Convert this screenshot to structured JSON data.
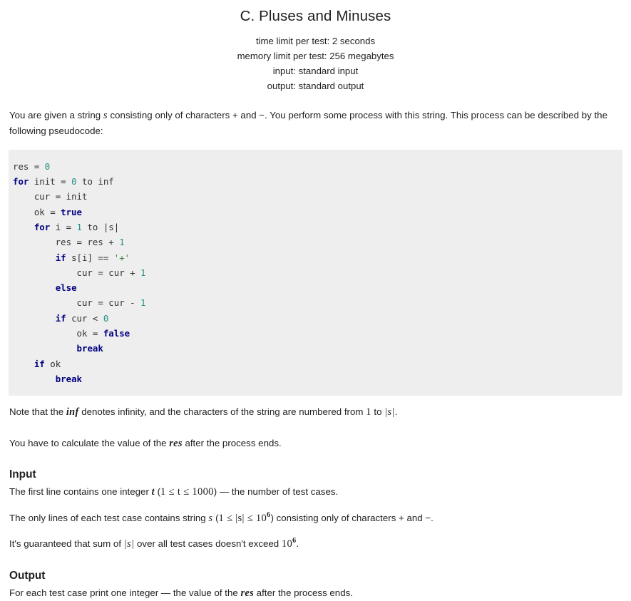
{
  "header": {
    "title": "C. Pluses and Minuses",
    "time_limit": "time limit per test: 2 seconds",
    "memory_limit": "memory limit per test: 256 megabytes",
    "input_spec": "input: standard input",
    "output_spec": "output: standard output"
  },
  "statement": {
    "part1": "You are given a string ",
    "var_s": "s",
    "part2": " consisting only of characters + and −. You perform some process with this string. This process can be described by the following pseudocode:"
  },
  "code": {
    "lines": [
      [
        {
          "t": "res ",
          "c": "id"
        },
        {
          "t": "= ",
          "c": "op"
        },
        {
          "t": "0",
          "c": "num"
        }
      ],
      [
        {
          "t": "for ",
          "c": "kw"
        },
        {
          "t": "init ",
          "c": "id"
        },
        {
          "t": "= ",
          "c": "op"
        },
        {
          "t": "0 ",
          "c": "num"
        },
        {
          "t": "to inf",
          "c": "id"
        }
      ],
      [
        {
          "t": "    cur ",
          "c": "id"
        },
        {
          "t": "= ",
          "c": "op"
        },
        {
          "t": "init",
          "c": "id"
        }
      ],
      [
        {
          "t": "    ok ",
          "c": "id"
        },
        {
          "t": "= ",
          "c": "op"
        },
        {
          "t": "true",
          "c": "kw"
        }
      ],
      [
        {
          "t": "    ",
          "c": "id"
        },
        {
          "t": "for ",
          "c": "kw"
        },
        {
          "t": "i ",
          "c": "id"
        },
        {
          "t": "= ",
          "c": "op"
        },
        {
          "t": "1 ",
          "c": "num"
        },
        {
          "t": "to |s|",
          "c": "id"
        }
      ],
      [
        {
          "t": "        res ",
          "c": "id"
        },
        {
          "t": "= ",
          "c": "op"
        },
        {
          "t": "res + ",
          "c": "id"
        },
        {
          "t": "1",
          "c": "num"
        }
      ],
      [
        {
          "t": "        ",
          "c": "id"
        },
        {
          "t": "if ",
          "c": "kw"
        },
        {
          "t": "s[i] == ",
          "c": "id"
        },
        {
          "t": "'+'",
          "c": "str"
        }
      ],
      [
        {
          "t": "            cur ",
          "c": "id"
        },
        {
          "t": "= ",
          "c": "op"
        },
        {
          "t": "cur + ",
          "c": "id"
        },
        {
          "t": "1",
          "c": "num"
        }
      ],
      [
        {
          "t": "        ",
          "c": "id"
        },
        {
          "t": "else",
          "c": "kw"
        }
      ],
      [
        {
          "t": "            cur ",
          "c": "id"
        },
        {
          "t": "= ",
          "c": "op"
        },
        {
          "t": "cur - ",
          "c": "id"
        },
        {
          "t": "1",
          "c": "num"
        }
      ],
      [
        {
          "t": "        ",
          "c": "id"
        },
        {
          "t": "if ",
          "c": "kw"
        },
        {
          "t": "cur < ",
          "c": "id"
        },
        {
          "t": "0",
          "c": "num"
        }
      ],
      [
        {
          "t": "            ok ",
          "c": "id"
        },
        {
          "t": "= ",
          "c": "op"
        },
        {
          "t": "false",
          "c": "kw"
        }
      ],
      [
        {
          "t": "            ",
          "c": "id"
        },
        {
          "t": "break",
          "c": "kw"
        }
      ],
      [
        {
          "t": "    ",
          "c": "id"
        },
        {
          "t": "if ",
          "c": "kw"
        },
        {
          "t": "ok",
          "c": "id"
        }
      ],
      [
        {
          "t": "        ",
          "c": "id"
        },
        {
          "t": "break",
          "c": "kw"
        }
      ]
    ]
  },
  "notes": {
    "note1_a": "Note that the ",
    "note1_inf": "inf",
    "note1_b": " denotes infinity, and the characters of the string are numbered from ",
    "note1_one": "1",
    "note1_c": " to ",
    "note1_abs_s": "|s|",
    "note1_d": ".",
    "note2_a": "You have to calculate the value of the ",
    "note2_res": "res",
    "note2_b": " after the process ends."
  },
  "input_section": {
    "title": "Input",
    "line1_a": "The first line contains one integer ",
    "line1_t": "t",
    "line1_b": " (",
    "line1_range": "1 ≤ t ≤ 1000",
    "line1_c": ") — the number of test cases.",
    "line2_a": "The only lines of each test case contains string ",
    "line2_s": "s",
    "line2_b": " (",
    "line2_range_lo": "1 ≤ |s| ≤ 10",
    "line2_range_exp": "6",
    "line2_c": ") consisting only of characters + and −.",
    "line3_a": "It's guaranteed that sum of ",
    "line3_abs_s": "|s|",
    "line3_b": " over all test cases doesn't exceed ",
    "line3_val": "10",
    "line3_exp": "6",
    "line3_c": "."
  },
  "output_section": {
    "title": "Output",
    "line1_a": "For each test case print one integer — the value of the ",
    "line1_res": "res",
    "line1_b": " after the process ends."
  },
  "colors": {
    "code_background": "#eeeeee",
    "keyword": "#000080",
    "number": "#269186",
    "string": "#408040",
    "text": "#1f1f1f"
  }
}
